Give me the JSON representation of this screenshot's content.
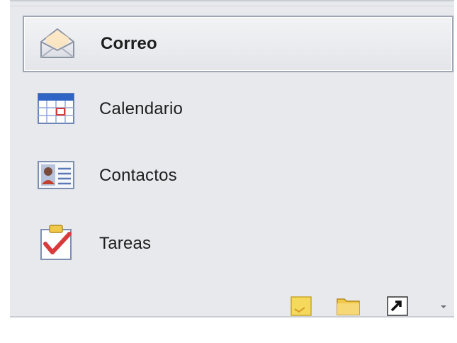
{
  "nav": {
    "items": [
      {
        "label": "Correo",
        "icon": "mail-envelope-icon",
        "selected": true
      },
      {
        "label": "Calendario",
        "icon": "calendar-icon",
        "selected": false
      },
      {
        "label": "Contactos",
        "icon": "contact-card-icon",
        "selected": false
      },
      {
        "label": "Tareas",
        "icon": "task-checkmark-icon",
        "selected": false
      }
    ]
  },
  "bottom_bar": {
    "buttons": [
      {
        "icon": "notes-icon"
      },
      {
        "icon": "folder-icon"
      },
      {
        "icon": "shortcut-icon"
      }
    ],
    "more_icon": "configure-buttons-arrow-icon"
  },
  "colors": {
    "pane_background": "#e7e9ed",
    "selected_border": "#9fa7b4",
    "text": "#1e1e1e",
    "calendar_header": "#2f63c4",
    "task_check": "#d83b3b",
    "notes_yellow": "#f4d95c",
    "folder_yellow": "#f0c94a"
  }
}
